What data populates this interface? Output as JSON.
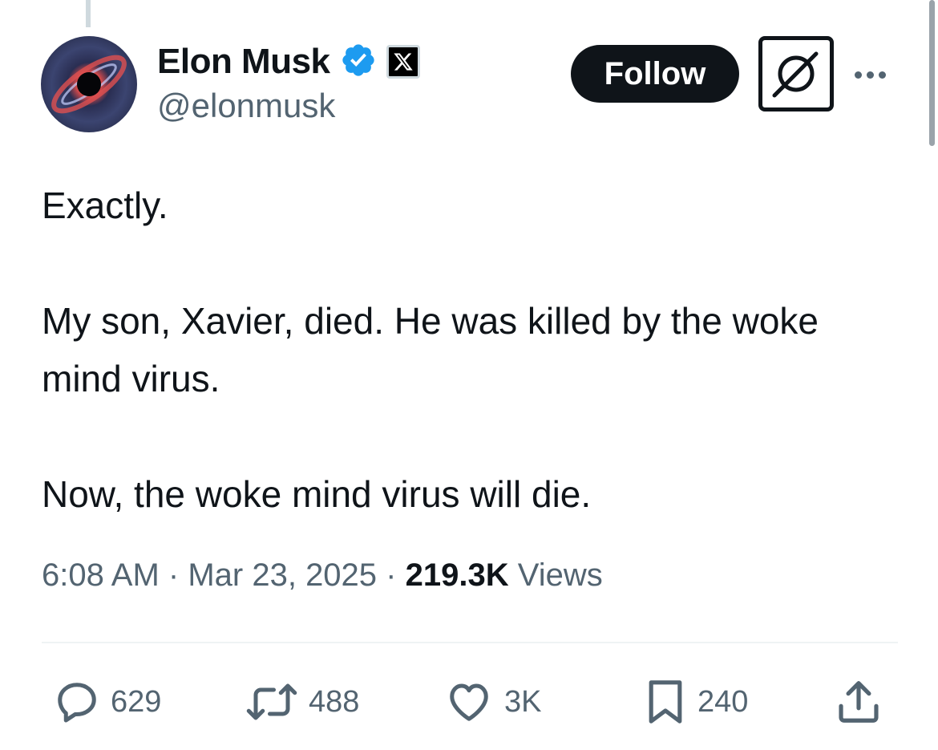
{
  "tweet": {
    "author": {
      "display_name": "Elon Musk",
      "handle": "@elonmusk",
      "verified_icon": "verified-badge-icon",
      "affiliation_icon": "x-logo-icon"
    },
    "header": {
      "follow_label": "Follow",
      "grok_icon": "grok-icon",
      "more_icon": "more-options-icon"
    },
    "paragraphs": [
      "Exactly.",
      "My son, Xavier, died. He was killed by the woke mind virus.",
      "Now, the woke mind virus will die."
    ],
    "meta": {
      "time": "6:08 AM",
      "separator": "·",
      "date": "Mar 23, 2025",
      "views_count": "219.3K",
      "views_label": "Views"
    },
    "actions": {
      "replies": "629",
      "reposts": "488",
      "likes": "3K",
      "bookmarks": "240"
    },
    "colors": {
      "text": "#0f1419",
      "secondary": "#536471",
      "verified": "#1d9bf0",
      "divider": "#eff3f4"
    }
  }
}
